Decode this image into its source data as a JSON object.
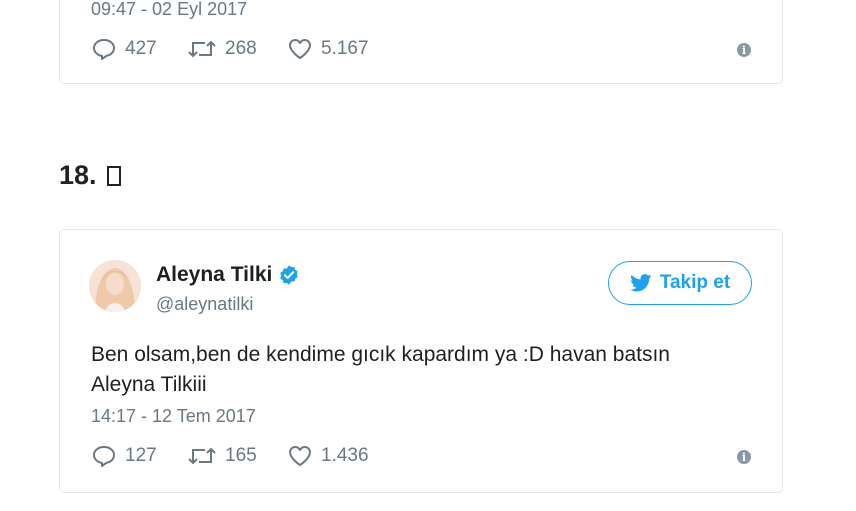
{
  "top_tweet": {
    "timestamp": "09:47 - 02 Eyl 2017",
    "replies": "427",
    "retweets": "268",
    "likes": "5.167"
  },
  "section": {
    "number": "18."
  },
  "tweet": {
    "author_name": "Aleyna Tilki",
    "handle": "@aleynatilki",
    "follow_label": "Takip et",
    "text_line1": "Ben olsam,ben de kendime gıcık kapardım ya :D havan batsın",
    "text_line2": "Aleyna Tilkiii",
    "timestamp": "14:17 - 12 Tem 2017",
    "replies": "127",
    "retweets": "165",
    "likes": "1.436"
  },
  "icons": {
    "reply": "reply-icon",
    "retweet": "retweet-icon",
    "like": "heart-icon",
    "info": "info-icon",
    "verified": "verified-badge-icon",
    "twitter": "twitter-bird-icon"
  },
  "colors": {
    "twitter_blue": "#1da1f2",
    "muted_text": "#697882",
    "border": "#e1e8ed"
  }
}
